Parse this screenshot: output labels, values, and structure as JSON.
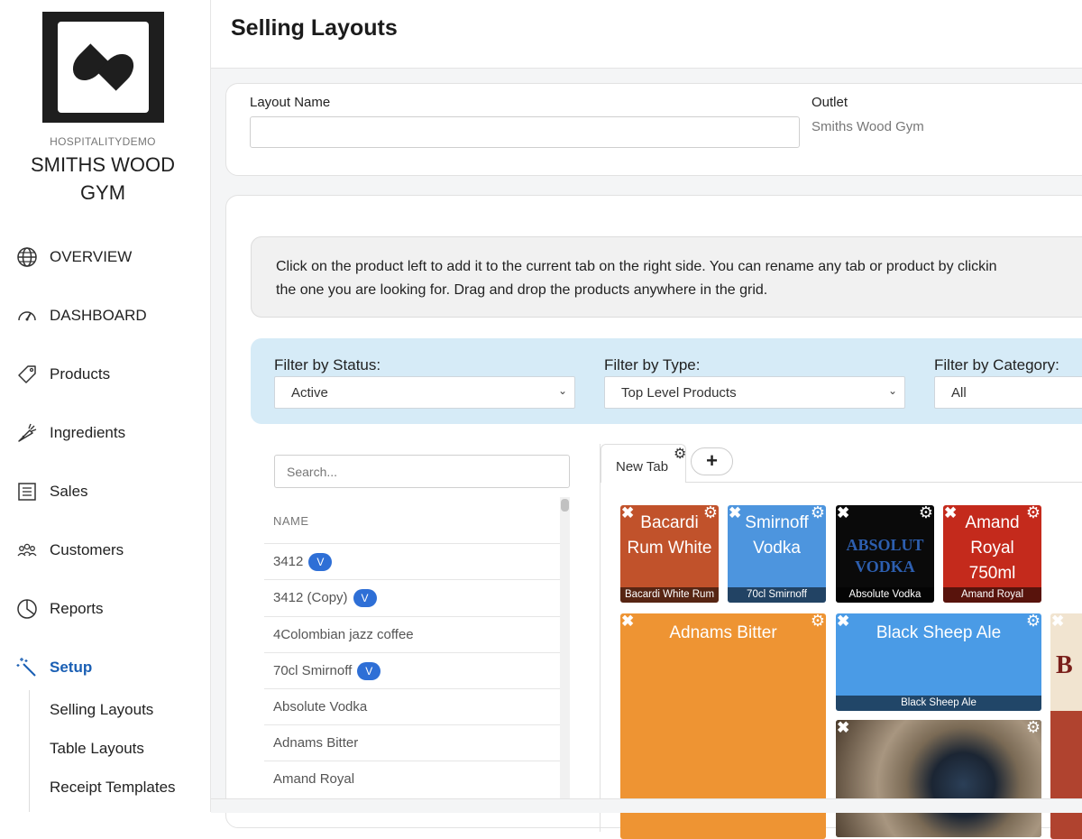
{
  "org": "HOSPITALITYDEMO",
  "venue": "SMITHS WOOD GYM",
  "nav": [
    {
      "label": "OVERVIEW",
      "icon": "globe-icon"
    },
    {
      "label": "DASHBOARD",
      "icon": "gauge-icon"
    },
    {
      "label": "Products",
      "icon": "tag-icon"
    },
    {
      "label": "Ingredients",
      "icon": "carrot-icon"
    },
    {
      "label": "Sales",
      "icon": "list-icon"
    },
    {
      "label": "Customers",
      "icon": "users-icon"
    },
    {
      "label": "Reports",
      "icon": "pie-chart-icon"
    },
    {
      "label": "Setup",
      "icon": "magic-wand-icon"
    }
  ],
  "subnav": [
    "Selling Layouts",
    "Table Layouts",
    "Receipt Templates"
  ],
  "page_title": "Selling Layouts",
  "form": {
    "layout_name_label": "Layout Name",
    "layout_name_value": "",
    "outlet_label": "Outlet",
    "outlet_value": "Smiths Wood Gym"
  },
  "info": {
    "line1": "Click on the product left to add it to the current tab on the right side. You can rename any tab or product by clickin",
    "line2": "the one you are looking for. Drag and drop the products anywhere in the grid."
  },
  "filters": {
    "status_label": "Filter by Status:",
    "status_value": "Active",
    "type_label": "Filter by Type:",
    "type_value": "Top Level Products",
    "category_label": "Filter by Category:",
    "category_value": "All"
  },
  "search_placeholder": "Search...",
  "list_header": "NAME",
  "badge_label": "V",
  "products": [
    {
      "name": "3412",
      "variant": true
    },
    {
      "name": "3412 (Copy)",
      "variant": true
    },
    {
      "name": "4Colombian jazz coffee",
      "variant": false
    },
    {
      "name": "70cl Smirnoff",
      "variant": true
    },
    {
      "name": "Absolute Vodka",
      "variant": false
    },
    {
      "name": "Adnams Bitter",
      "variant": false
    },
    {
      "name": "Amand Royal",
      "variant": false
    }
  ],
  "tab": {
    "label": "New Tab",
    "add_label": "+"
  },
  "tiles": [
    {
      "title": "Bacardi Rum White",
      "caption": "Bacardi White Rum",
      "color": "#c1522b"
    },
    {
      "title": "Smirnoff Vodka",
      "caption": "70cl Smirnoff",
      "color": "#4d95de"
    },
    {
      "title": "",
      "caption": "Absolute Vodka",
      "color": "#0a0a0a",
      "brand": "ABSOLUT VODKA"
    },
    {
      "title": "Amand Royal 750ml",
      "caption": "Amand Royal",
      "color": "#c42a1c"
    },
    {
      "title": "Adnams Bitter",
      "caption": "",
      "color": "#ee9433"
    },
    {
      "title": "Black Sheep Ale",
      "caption": "Black Sheep Ale",
      "color": "#4a9be6"
    },
    {
      "title": "",
      "caption": "",
      "color": "#5a4a3a"
    },
    {
      "title": "",
      "caption": "",
      "color": "#f1e4d0",
      "brand": "B"
    }
  ]
}
